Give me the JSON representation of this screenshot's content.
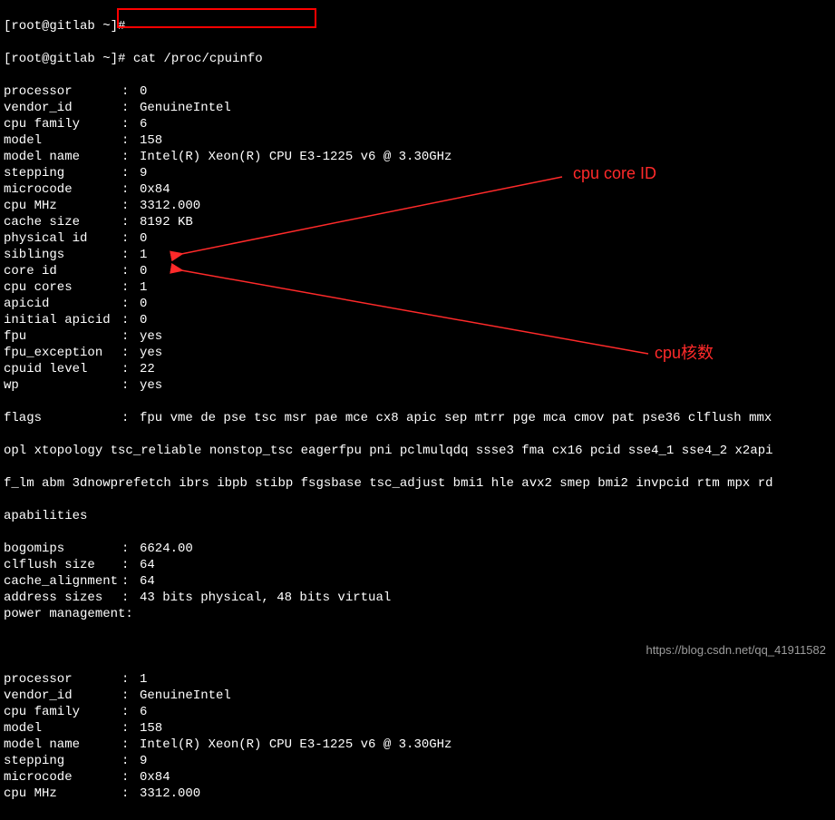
{
  "prompt_top": "[root@gitlab ~]# ",
  "command": "cat /proc/cpuinfo",
  "prompt_prefix_broken": "[root@gitlab ~]#",
  "cpu0": [
    {
      "label": "processor",
      "value": "0"
    },
    {
      "label": "vendor_id",
      "value": "GenuineIntel"
    },
    {
      "label": "cpu family",
      "value": "6"
    },
    {
      "label": "model",
      "value": "158"
    },
    {
      "label": "model name",
      "value": "Intel(R) Xeon(R) CPU E3-1225 v6 @ 3.30GHz"
    },
    {
      "label": "stepping",
      "value": "9"
    },
    {
      "label": "microcode",
      "value": "0x84"
    },
    {
      "label": "cpu MHz",
      "value": "3312.000"
    },
    {
      "label": "cache size",
      "value": "8192 KB"
    },
    {
      "label": "physical id",
      "value": "0"
    },
    {
      "label": "siblings",
      "value": "1"
    },
    {
      "label": "core id",
      "value": "0"
    },
    {
      "label": "cpu cores",
      "value": "1"
    },
    {
      "label": "apicid",
      "value": "0"
    },
    {
      "label": "initial apicid",
      "value": "0"
    },
    {
      "label": "fpu",
      "value": "yes"
    },
    {
      "label": "fpu_exception",
      "value": "yes"
    },
    {
      "label": "cpuid level",
      "value": "22"
    },
    {
      "label": "wp",
      "value": "yes"
    }
  ],
  "flags_label": "flags",
  "flags_line1": "fpu vme de pse tsc msr pae mce cx8 apic sep mtrr pge mca cmov pat pse36 clflush mmx",
  "flags_line2": "opl xtopology tsc_reliable nonstop_tsc eagerfpu pni pclmulqdq ssse3 fma cx16 pcid sse4_1 sse4_2 x2api",
  "flags_line3": "f_lm abm 3dnowprefetch ibrs ibpb stibp fsgsbase tsc_adjust bmi1 hle avx2 smep bmi2 invpcid rtm mpx rd",
  "flags_line4": "apabilities",
  "cpu0_tail": [
    {
      "label": "bogomips",
      "value": "6624.00"
    },
    {
      "label": "clflush size",
      "value": "64"
    },
    {
      "label": "cache_alignment",
      "value": "64"
    },
    {
      "label": "address sizes",
      "value": "43 bits physical, 48 bits virtual"
    },
    {
      "label": "power management",
      "value": ""
    }
  ],
  "cpu1": [
    {
      "label": "processor",
      "value": "1"
    },
    {
      "label": "vendor_id",
      "value": "GenuineIntel"
    },
    {
      "label": "cpu family",
      "value": "6"
    },
    {
      "label": "model",
      "value": "158"
    },
    {
      "label": "model name",
      "value": "Intel(R) Xeon(R) CPU E3-1225 v6 @ 3.30GHz"
    },
    {
      "label": "stepping",
      "value": "9"
    },
    {
      "label": "microcode",
      "value": "0x84"
    },
    {
      "label": "cpu MHz",
      "value": "3312.000"
    }
  ],
  "annotation1": "cpu core ID",
  "annotation2": "cpu核数",
  "watermark": "https://blog.csdn.net/qq_41911582"
}
